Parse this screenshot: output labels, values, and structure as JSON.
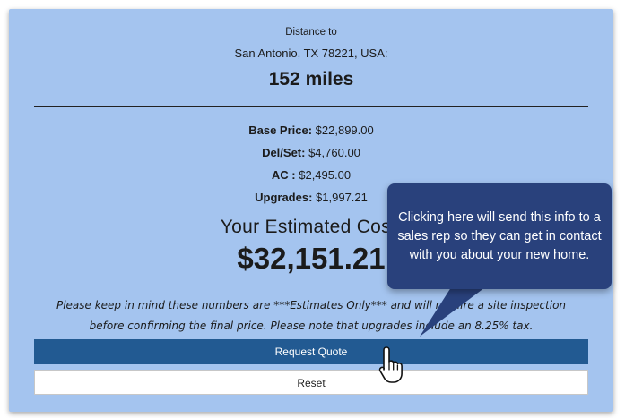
{
  "distance": {
    "label": "Distance to",
    "destination": "San Antonio, TX 78221, USA:",
    "miles": "152 miles"
  },
  "pricing": {
    "rows": [
      {
        "label": "Base Price:",
        "value": " $22,899.00"
      },
      {
        "label": "Del/Set:",
        "value": " $4,760.00"
      },
      {
        "label": "AC :",
        "value": " $2,495.00"
      },
      {
        "label": "Upgrades:",
        "value": " $1,997.21"
      }
    ],
    "estimated_label": "Your Estimated Cost:",
    "estimated_value": "$32,151.21"
  },
  "disclaimer": "Please keep in mind these numbers are ***Estimates Only*** and will require a site inspection before confirming the final price. Please note that upgrades include an 8.25% tax.",
  "buttons": {
    "request_quote": "Request Quote",
    "reset": "Reset"
  },
  "tooltip": {
    "text": "Clicking here will send this info to a sales rep so they can get in contact with you about your new home."
  },
  "colors": {
    "panel_bg": "#a4c4ef",
    "primary_button": "#225a92",
    "tooltip_bg": "#29417c"
  }
}
